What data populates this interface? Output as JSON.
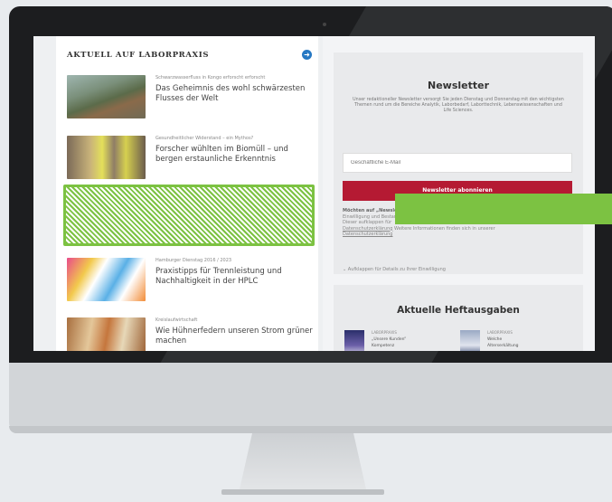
{
  "feed": {
    "title": "AKTUELL AUF LABORPRAXIS",
    "articles": [
      {
        "kicker": "Schwarzwasserfluss in Kongo erforscht erforscht",
        "headline": "Das Geheimnis des wohl schwärzesten Flusses der Welt"
      },
      {
        "kicker": "Gesundheitlicher Widerstand – ein Mythos?",
        "headline": "Forscher wühlten im Biomüll – und bergen erstaunliche Erkenntnis"
      },
      {
        "kicker": "Hamburger Dienstag 2016 / 2023",
        "headline": "Praxistipps für Trennleistung und Nachhaltigkeit in der HPLC"
      },
      {
        "kicker": "Kreislaufwirtschaft",
        "headline": "Wie Hühnerfedern unseren Strom grüner machen"
      }
    ]
  },
  "newsletter": {
    "title": "Newsletter",
    "description": "Unser redaktioneller Newsletter versorgt Sie jeden Dienstag und Donnerstag mit den wichtigsten Themen rund um die Bereiche Analytik, Laborbedarf, Laborttechnik, Lebenswissenschaften und Life Sciences.",
    "email_placeholder": "Geschäftliche E-Mail",
    "subscribe_label": "Newsletter abonnieren",
    "consent_bold": "Möchten auf „Newsletter",
    "consent_text": "Einwilligung und Bestandteile",
    "consent_text2": "Dieser aufklappen für",
    "consent_link": "Datenschutzerklärung",
    "consent_rest": "Weitere Informationen finden sich in unserer",
    "consent_link2": "Datenschutzerklärung",
    "toggle_label": "Aufklappen für Details zu Ihrer Einwilligung"
  },
  "magazines": {
    "title": "Aktuelle Heftausgaben",
    "items": [
      {
        "kicker": "LABORPRAXIS",
        "line1": "„Unsere Kunden“",
        "line2": "Kompetenz"
      },
      {
        "kicker": "LABORPRAXIS",
        "line1": "Welche",
        "line2": "Alterserkältung"
      }
    ]
  },
  "colors": {
    "accent_red": "#b51a33",
    "highlight_green": "#7cc242",
    "link_blue": "#2678c3"
  }
}
